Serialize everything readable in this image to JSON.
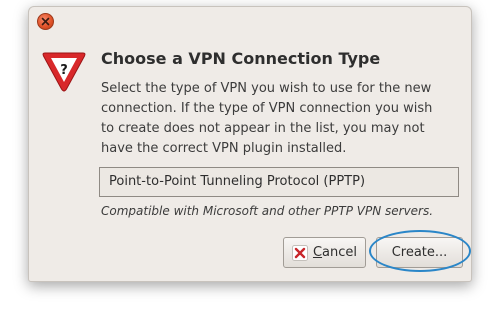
{
  "dialog": {
    "heading": "Choose a VPN Connection Type",
    "description": "Select the type of VPN you wish to use for the new connection.  If the type of VPN connection you wish to create does not appear in the list, you may not have the correct VPN plugin installed.",
    "connection_type": {
      "selected": "Point-to-Point Tunneling Protocol (PPTP)"
    },
    "compatibility_note": "Compatible with Microsoft and other PPTP VPN servers.",
    "buttons": {
      "cancel_label": "Cancel",
      "create_label": "Create..."
    },
    "icons": {
      "close": "close-icon",
      "warning": "warning-question-icon",
      "cancel": "cancel-x-icon"
    },
    "colors": {
      "close_button": "#e2542b",
      "warning_triangle": "#d8282a",
      "highlight_ring": "#2a86c8"
    }
  }
}
